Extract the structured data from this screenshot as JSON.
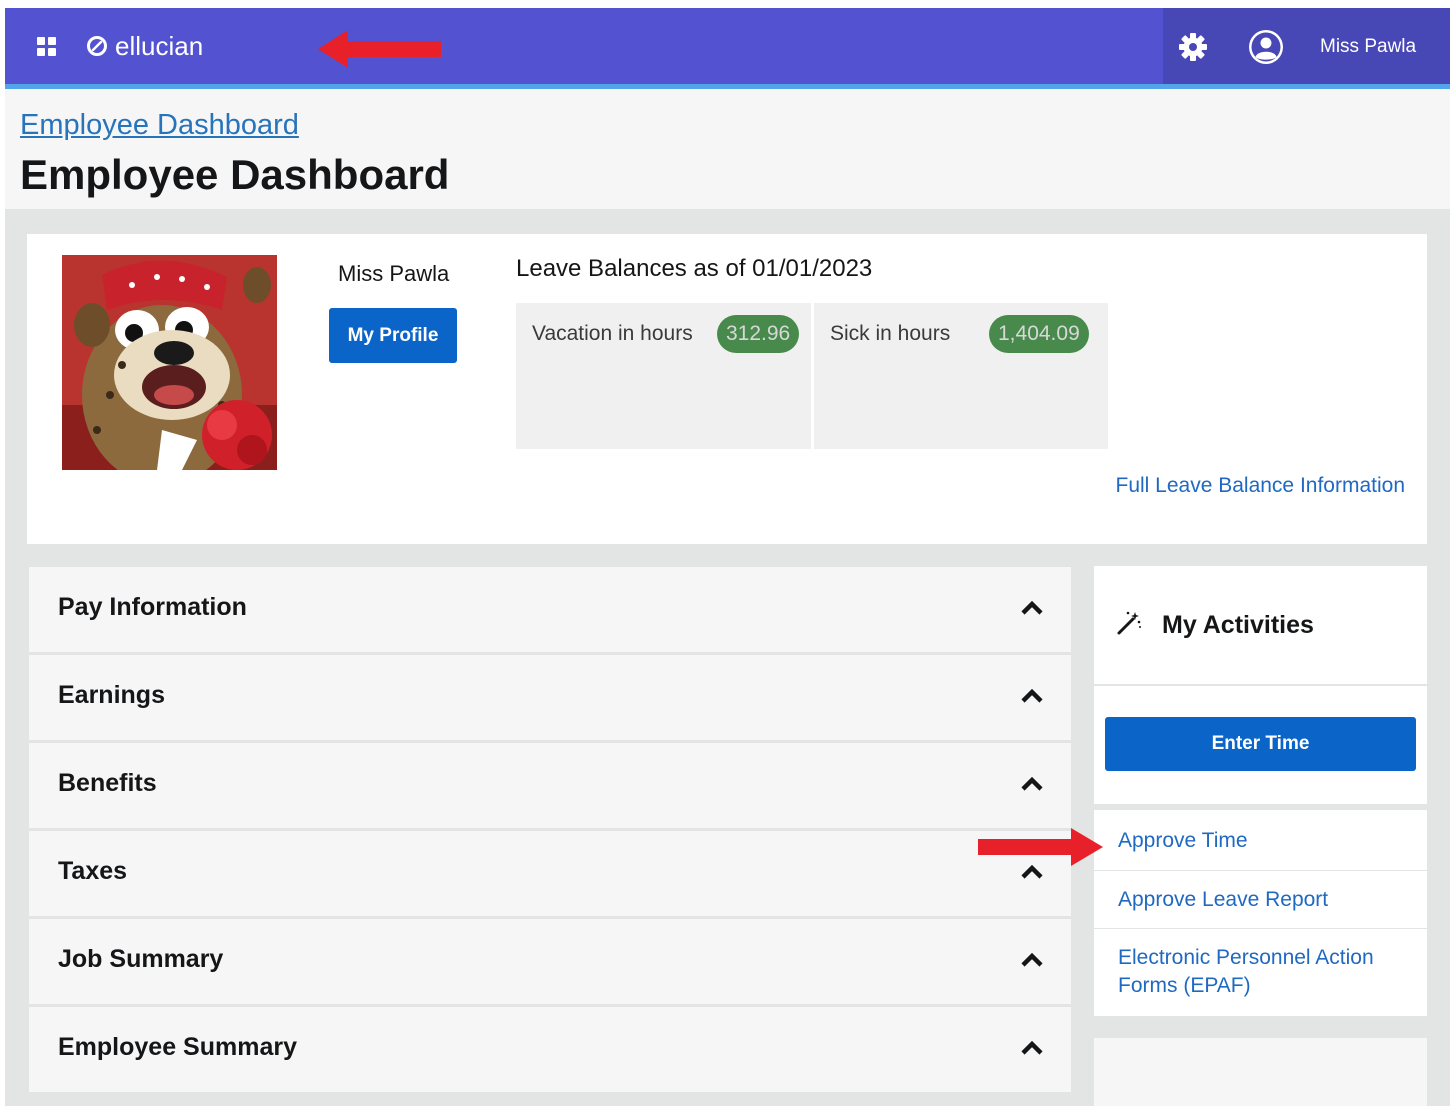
{
  "app": {
    "brand": "ellucian",
    "user_name": "Miss Pawla"
  },
  "header": {
    "breadcrumb": "Employee Dashboard",
    "title": "Employee Dashboard"
  },
  "profile": {
    "name": "Miss Pawla",
    "my_profile_label": "My Profile"
  },
  "leave": {
    "title": "Leave Balances as of 01/01/2023",
    "balances": [
      {
        "label": "Vacation in hours",
        "value": "312.96"
      },
      {
        "label": "Sick in hours",
        "value": "1,404.09"
      }
    ],
    "full_link": "Full Leave Balance Information"
  },
  "sections": [
    {
      "label": "Pay Information"
    },
    {
      "label": "Earnings"
    },
    {
      "label": "Benefits"
    },
    {
      "label": "Taxes"
    },
    {
      "label": "Job Summary"
    },
    {
      "label": "Employee Summary"
    }
  ],
  "activities": {
    "title": "My Activities",
    "enter_time_label": "Enter Time",
    "links": [
      {
        "label": "Approve Time"
      },
      {
        "label": "Approve Leave Report"
      },
      {
        "label": "Electronic Personnel Action Forms (EPAF)"
      }
    ]
  },
  "colors": {
    "topbar": "#5353d1",
    "accent": "#53a4e8",
    "primary_button": "#0b64c7",
    "badge": "#478a4c",
    "link": "#1f69c2",
    "annotation_arrow": "#e8202a"
  },
  "icons": [
    "apps-grid-icon",
    "ellucian-logo-icon",
    "gear-icon",
    "user-circle-icon",
    "magic-wand-icon",
    "chevron-up-icon"
  ]
}
